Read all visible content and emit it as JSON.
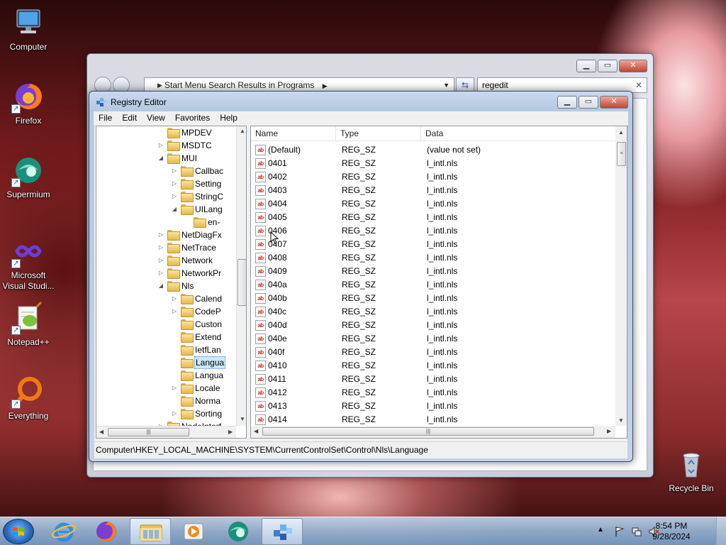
{
  "desktop": {
    "icons": [
      {
        "label": "Computer"
      },
      {
        "label": "Firefox"
      },
      {
        "label": "Supermium"
      },
      {
        "label": "Microsoft Visual Studi..."
      },
      {
        "label": "Notepad++"
      },
      {
        "label": "Everything"
      },
      {
        "label": "Recycle Bin"
      }
    ]
  },
  "explorer": {
    "address": "Start Menu Search Results in Programs",
    "search_value": "regedit"
  },
  "regedit": {
    "title": "Registry Editor",
    "menu": [
      "File",
      "Edit",
      "View",
      "Favorites",
      "Help"
    ],
    "tree": [
      {
        "label": "MPDEV",
        "level": 1,
        "expander": ""
      },
      {
        "label": "MSDTC",
        "level": 1,
        "expander": "▷"
      },
      {
        "label": "MUI",
        "level": 1,
        "expander": "◢"
      },
      {
        "label": "Callbac",
        "level": 2,
        "expander": "▷"
      },
      {
        "label": "Setting",
        "level": 2,
        "expander": "▷"
      },
      {
        "label": "StringC",
        "level": 2,
        "expander": "▷"
      },
      {
        "label": "UILang",
        "level": 2,
        "expander": "◢"
      },
      {
        "label": "en-",
        "level": 3,
        "expander": ""
      },
      {
        "label": "NetDiagFx",
        "level": 1,
        "expander": "▷"
      },
      {
        "label": "NetTrace",
        "level": 1,
        "expander": "▷"
      },
      {
        "label": "Network",
        "level": 1,
        "expander": "▷"
      },
      {
        "label": "NetworkPr",
        "level": 1,
        "expander": "▷"
      },
      {
        "label": "Nls",
        "level": 1,
        "expander": "◢"
      },
      {
        "label": "Calend",
        "level": 2,
        "expander": "▷"
      },
      {
        "label": "CodeP",
        "level": 2,
        "expander": "▷"
      },
      {
        "label": "Custon",
        "level": 2,
        "expander": ""
      },
      {
        "label": "Extend",
        "level": 2,
        "expander": ""
      },
      {
        "label": "IetfLan",
        "level": 2,
        "expander": ""
      },
      {
        "label": "Langua",
        "level": 2,
        "expander": "",
        "selected": true
      },
      {
        "label": "Langua",
        "level": 2,
        "expander": ""
      },
      {
        "label": "Locale",
        "level": 2,
        "expander": "▷"
      },
      {
        "label": "Norma",
        "level": 2,
        "expander": ""
      },
      {
        "label": "Sorting",
        "level": 2,
        "expander": "▷"
      },
      {
        "label": "NodeInterf",
        "level": 1,
        "expander": "▷"
      }
    ],
    "columns": {
      "name": "Name",
      "type": "Type",
      "data": "Data"
    },
    "rows": [
      {
        "name": "(Default)",
        "type": "REG_SZ",
        "data": "(value not set)"
      },
      {
        "name": "0401",
        "type": "REG_SZ",
        "data": "l_intl.nls"
      },
      {
        "name": "0402",
        "type": "REG_SZ",
        "data": "l_intl.nls"
      },
      {
        "name": "0403",
        "type": "REG_SZ",
        "data": "l_intl.nls"
      },
      {
        "name": "0404",
        "type": "REG_SZ",
        "data": "l_intl.nls"
      },
      {
        "name": "0405",
        "type": "REG_SZ",
        "data": "l_intl.nls"
      },
      {
        "name": "0406",
        "type": "REG_SZ",
        "data": "l_intl.nls"
      },
      {
        "name": "0407",
        "type": "REG_SZ",
        "data": "l_intl.nls"
      },
      {
        "name": "0408",
        "type": "REG_SZ",
        "data": "l_intl.nls"
      },
      {
        "name": "0409",
        "type": "REG_SZ",
        "data": "l_intl.nls"
      },
      {
        "name": "040a",
        "type": "REG_SZ",
        "data": "l_intl.nls"
      },
      {
        "name": "040b",
        "type": "REG_SZ",
        "data": "l_intl.nls"
      },
      {
        "name": "040c",
        "type": "REG_SZ",
        "data": "l_intl.nls"
      },
      {
        "name": "040d",
        "type": "REG_SZ",
        "data": "l_intl.nls"
      },
      {
        "name": "040e",
        "type": "REG_SZ",
        "data": "l_intl.nls"
      },
      {
        "name": "040f",
        "type": "REG_SZ",
        "data": "l_intl.nls"
      },
      {
        "name": "0410",
        "type": "REG_SZ",
        "data": "l_intl.nls"
      },
      {
        "name": "0411",
        "type": "REG_SZ",
        "data": "l_intl.nls"
      },
      {
        "name": "0412",
        "type": "REG_SZ",
        "data": "l_intl.nls"
      },
      {
        "name": "0413",
        "type": "REG_SZ",
        "data": "l_intl.nls"
      },
      {
        "name": "0414",
        "type": "REG_SZ",
        "data": "l_intl.nls"
      }
    ],
    "value_icon": "ab",
    "status": "Computer\\HKEY_LOCAL_MACHINE\\SYSTEM\\CurrentControlSet\\Control\\Nls\\Language"
  },
  "taskbar": {
    "apps": [
      "internet-explorer",
      "firefox",
      "file-explorer",
      "media-player",
      "supermium",
      "registry-editor"
    ],
    "time": "8:54 PM",
    "date": "9/28/2024"
  }
}
